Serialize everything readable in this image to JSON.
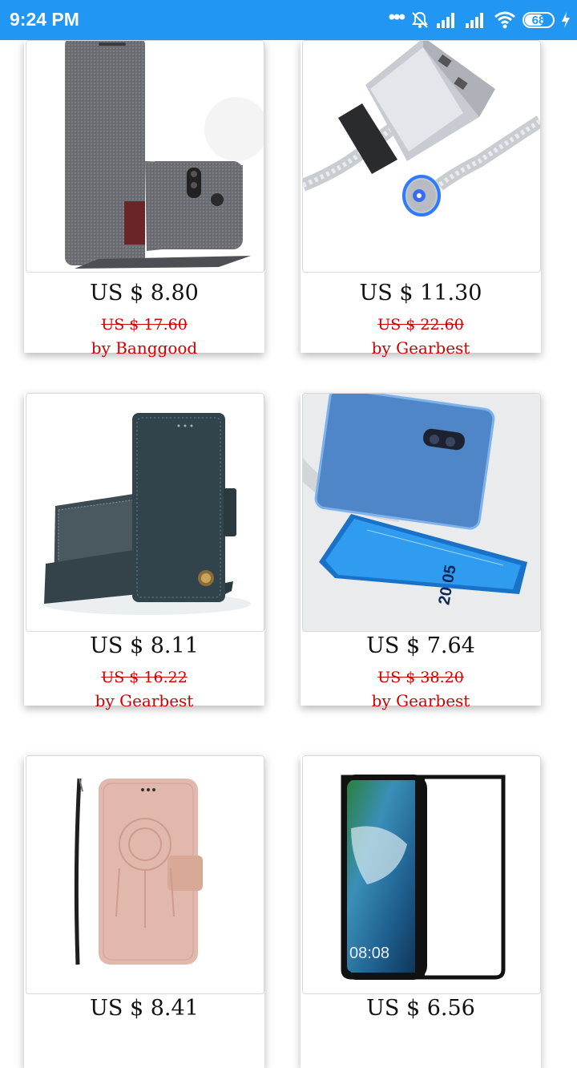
{
  "status_bar": {
    "time": "9:24 PM",
    "battery_level": "68",
    "icons": [
      "more-dots-icon",
      "alarm-off-icon",
      "signal-icon",
      "signal-icon",
      "wifi-icon",
      "battery-icon",
      "charging-icon"
    ]
  },
  "products": [
    {
      "price": "US $ 8.80",
      "old_price": "US $ 17.60",
      "seller": "by Banggood",
      "image": "fabric-flip-phone-case"
    },
    {
      "price": "US $ 11.30",
      "old_price": "US $ 22.60",
      "seller": "by Gearbest",
      "image": "magnetic-usb-cable"
    },
    {
      "price": "US $ 8.11",
      "old_price": "US $ 16.22",
      "seller": "by Gearbest",
      "image": "leather-wallet-case-dark"
    },
    {
      "price": "US $ 7.64",
      "old_price": "US $ 38.20",
      "seller": "by Gearbest",
      "image": "mirror-clear-view-case-blue"
    },
    {
      "price": "US $ 8.41",
      "old_price": "",
      "seller": "",
      "image": "pink-embossed-wallet-case"
    },
    {
      "price": "US $ 6.56",
      "old_price": "",
      "seller": "",
      "image": "tempered-glass-screen-protector"
    }
  ],
  "screen_protector_clock": "08:08",
  "mirror_case_clock": "20 05",
  "colors": {
    "status_bar": "#2196f3",
    "old_price": "#d00000",
    "seller": "#d00000"
  }
}
